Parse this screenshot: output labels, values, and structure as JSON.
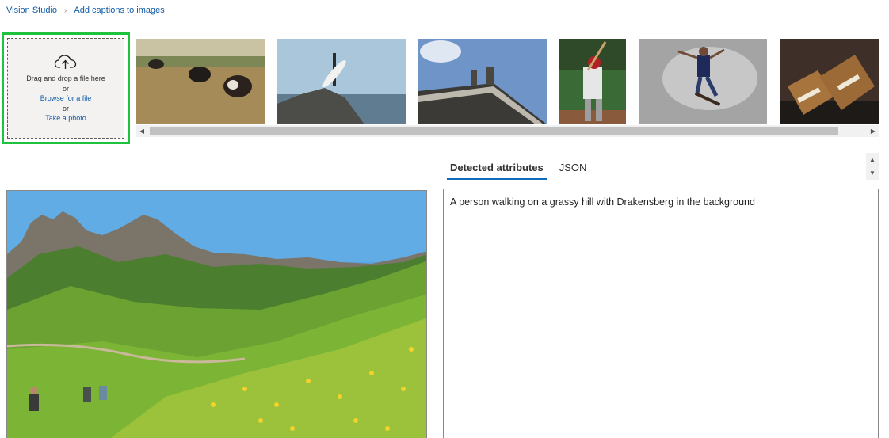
{
  "breadcrumb": {
    "root": "Vision Studio",
    "separator": "›",
    "current": "Add captions to images"
  },
  "upload": {
    "drag_text": "Drag and drop a file here",
    "or_1": "or",
    "browse_link": "Browse for a file",
    "or_2": "or",
    "photo_link": "Take a photo"
  },
  "thumbnails": [
    "cows-in-field",
    "surfer-on-rock",
    "building-statues",
    "baseball-batter",
    "skateboarder",
    "sandwich"
  ],
  "tabs": [
    {
      "label": "Detected attributes",
      "active": true
    },
    {
      "label": "JSON",
      "active": false
    }
  ],
  "result": {
    "caption": "A person walking on a grassy hill with Drakensberg in the background"
  },
  "colors": {
    "accent": "#0f6cbd",
    "link": "#0f5ba8",
    "upload_highlight": "#1fc23f"
  }
}
